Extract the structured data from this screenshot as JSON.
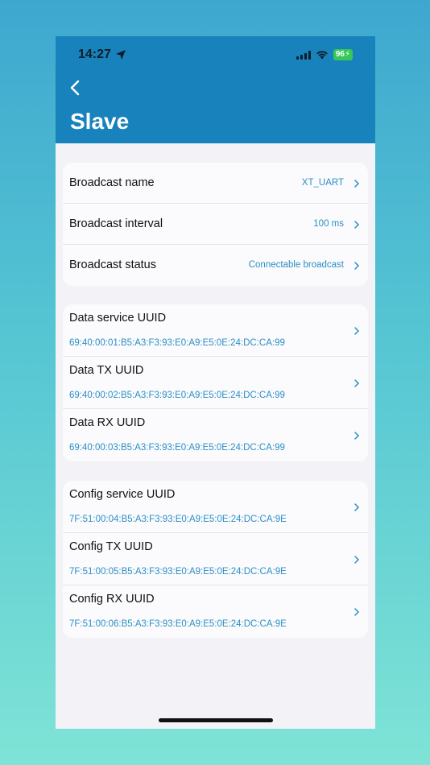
{
  "status_bar": {
    "time": "14:27",
    "battery": "96"
  },
  "nav": {
    "title": "Slave"
  },
  "broadcast": [
    {
      "label": "Broadcast name",
      "value": "XT_UART"
    },
    {
      "label": "Broadcast interval",
      "value": "100 ms"
    },
    {
      "label": "Broadcast status",
      "value": "Connectable broadcast"
    }
  ],
  "data_uuids": [
    {
      "label": "Data service UUID",
      "value": "69:40:00:01:B5:A3:F3:93:E0:A9:E5:0E:24:DC:CA:99"
    },
    {
      "label": "Data TX UUID",
      "value": "69:40:00:02:B5:A3:F3:93:E0:A9:E5:0E:24:DC:CA:99"
    },
    {
      "label": "Data RX UUID",
      "value": "69:40:00:03:B5:A3:F3:93:E0:A9:E5:0E:24:DC:CA:99"
    }
  ],
  "config_uuids": [
    {
      "label": "Config service UUID",
      "value": "7F:51:00:04:B5:A3:F3:93:E0:A9:E5:0E:24:DC:CA:9E"
    },
    {
      "label": "Config TX UUID",
      "value": "7F:51:00:05:B5:A3:F3:93:E0:A9:E5:0E:24:DC:CA:9E"
    },
    {
      "label": "Config RX UUID",
      "value": "7F:51:00:06:B5:A3:F3:93:E0:A9:E5:0E:24:DC:CA:9E"
    }
  ],
  "colors": {
    "header": "#1882bc",
    "accent_text": "#2b8fc4",
    "battery": "#35c759"
  }
}
